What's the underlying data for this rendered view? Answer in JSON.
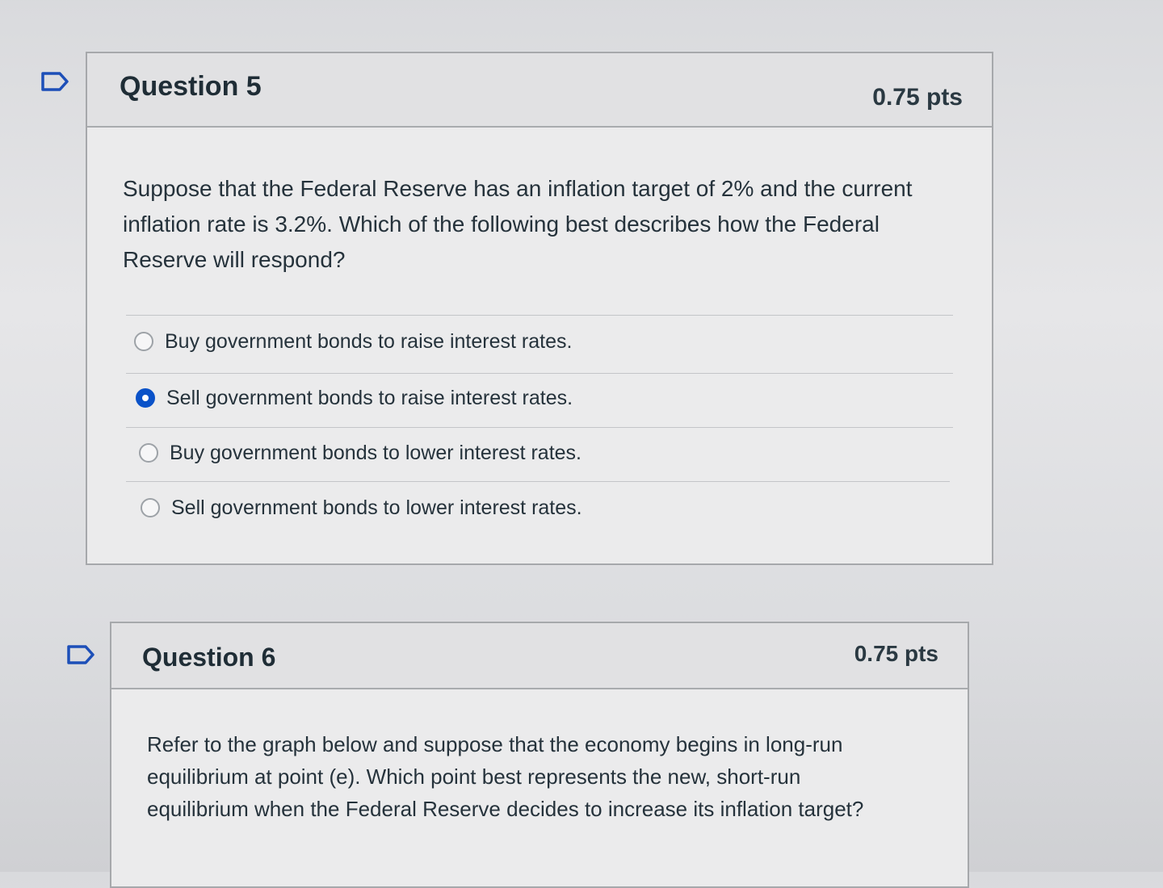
{
  "questions": [
    {
      "title": "Question 5",
      "points": "0.75 pts",
      "text_lines": [
        "Suppose that the Federal Reserve has an inflation target of 2% and the current",
        "inflation rate is 3.2%. Which of the following best describes how the Federal",
        "Reserve will respond?"
      ],
      "answers": [
        {
          "label": "Buy government bonds to raise interest rates.",
          "selected": false
        },
        {
          "label": "Sell government bonds to raise interest rates.",
          "selected": true
        },
        {
          "label": "Buy government bonds to lower interest rates.",
          "selected": false
        },
        {
          "label": "Sell government bonds to lower interest rates.",
          "selected": false
        }
      ]
    },
    {
      "title": "Question 6",
      "points": "0.75 pts",
      "text_lines": [
        "Refer to the graph below and suppose that the economy begins in long-run",
        "equilibrium at point (e). Which point best represents the new, short-run",
        "equilibrium when the Federal Reserve decides to increase its inflation target?"
      ]
    }
  ],
  "colors": {
    "selected_radio": "#0a52c8",
    "flag_outline": "#1d4fb8"
  },
  "icons": {
    "flag": "flag-question-icon",
    "radio_selected": "radio-selected-icon",
    "radio_unselected": "radio-unselected-icon"
  }
}
